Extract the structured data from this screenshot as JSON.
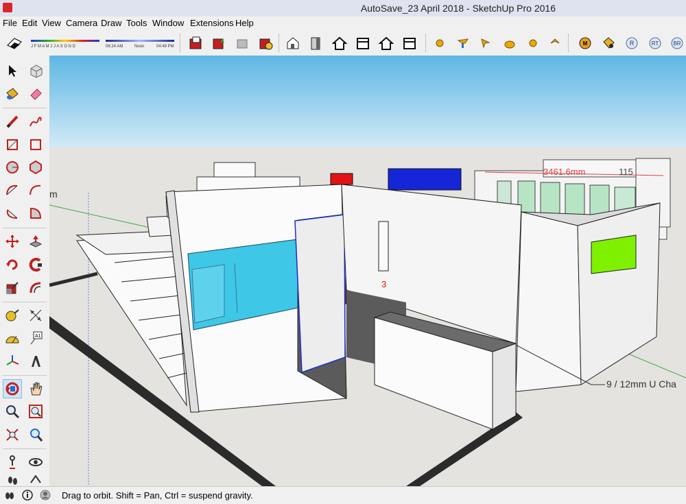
{
  "window": {
    "title": "AutoSave_23 April 2018 - SketchUp Pro 2016"
  },
  "menu": [
    "File",
    "Edit",
    "View",
    "Camera",
    "Draw",
    "Tools",
    "Window",
    "Extensions",
    "Help"
  ],
  "toolbar": {
    "shadow_months": "J F M A M J J A S O N D",
    "shadow_time_start": "06:24 AM",
    "shadow_time_mid": "Noon",
    "shadow_time_end": "04:49 PM",
    "plugin_labels": [
      "M",
      "R",
      "RT",
      "BR"
    ]
  },
  "viewport": {
    "dimension_label": "3461.6mm",
    "dimension_label_2": "115",
    "callout_label": "9 / 12mm U Cha",
    "axis_label": "m",
    "axis_label_2": "3"
  },
  "status": {
    "message": "Drag to orbit. Shift = Pan, Ctrl = suspend gravity."
  },
  "colors": {
    "sky_top": "#5eb7e4",
    "sky_bottom": "#d4eaf7",
    "ground": "#e4e3e0",
    "glass": "#3ec7e6",
    "red": "#e01414",
    "blue": "#1526d8",
    "green": "#7ff000"
  }
}
